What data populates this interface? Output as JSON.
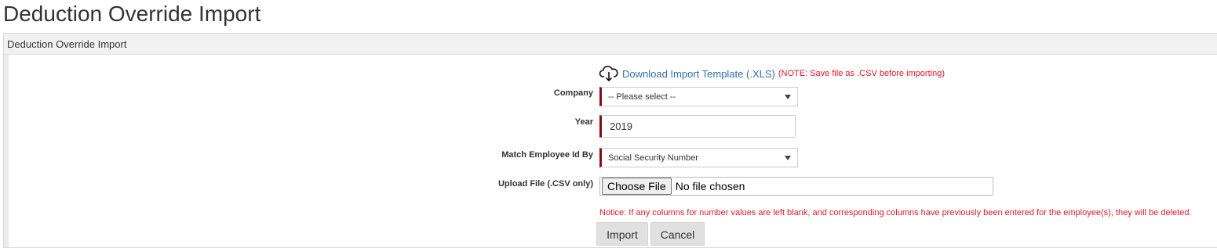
{
  "page": {
    "title": "Deduction Override Import"
  },
  "panel": {
    "header": "Deduction Override Import"
  },
  "download": {
    "icon": "cloud-download-icon",
    "link_label": "Download Import Template (.XLS)",
    "note": "(NOTE: Save file as .CSV before importing)"
  },
  "form": {
    "company": {
      "label": "Company",
      "value": "-- Please select --"
    },
    "year": {
      "label": "Year",
      "value": "2019"
    },
    "match": {
      "label": "Match Employee Id By",
      "value": "Social Security Number"
    },
    "upload": {
      "label": "Upload File (.CSV only)",
      "button_label": "Choose File",
      "status": "No file chosen"
    }
  },
  "notice": "Notice: If any columns for number values are left blank, and corresponding columns have previously been entered for the employee(s), they will be deleted.",
  "actions": {
    "import_label": "Import",
    "cancel_label": "Cancel"
  },
  "colors": {
    "required_marker": "#8b0a17",
    "link": "#2f6fad",
    "warning": "#e0182d"
  }
}
